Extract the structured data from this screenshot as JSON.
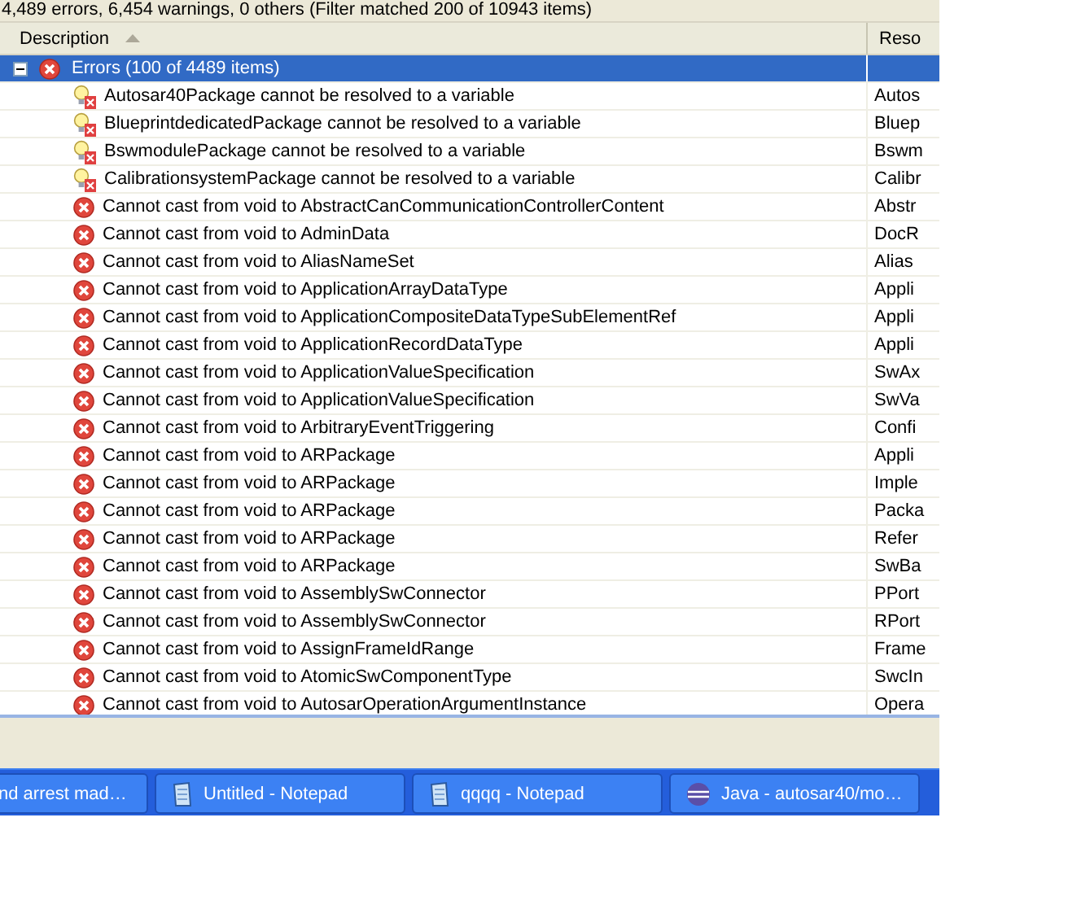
{
  "status_text": "4,489 errors, 6,454 warnings, 0 others (Filter matched 200 of 10943 items)",
  "table": {
    "columns": [
      {
        "label": "Description",
        "sorted": true
      },
      {
        "label": "Reso"
      }
    ],
    "group": {
      "label": "Errors (100 of 4489 items)",
      "expanded": true,
      "selected": true,
      "rows": [
        {
          "kind": "unresolved",
          "description": "Autosar40Package cannot be resolved to a variable",
          "resource": "Autos",
          "selected": false
        },
        {
          "kind": "unresolved",
          "description": "BlueprintdedicatedPackage cannot be resolved to a variable",
          "resource": "Bluep",
          "selected": false
        },
        {
          "kind": "unresolved",
          "description": "BswmodulePackage cannot be resolved to a variable",
          "resource": "Bswm",
          "selected": false
        },
        {
          "kind": "unresolved",
          "description": "CalibrationsystemPackage cannot be resolved to a variable",
          "resource": "Calibr",
          "selected": false
        },
        {
          "kind": "error",
          "description": "Cannot cast from void to AbstractCanCommunicationControllerContent",
          "resource": "Abstr",
          "selected": false
        },
        {
          "kind": "error",
          "description": "Cannot cast from void to AdminData",
          "resource": "DocR",
          "selected": false
        },
        {
          "kind": "error",
          "description": "Cannot cast from void to AliasNameSet",
          "resource": "Alias",
          "selected": false
        },
        {
          "kind": "error",
          "description": "Cannot cast from void to ApplicationArrayDataType",
          "resource": "Appli",
          "selected": false
        },
        {
          "kind": "error",
          "description": "Cannot cast from void to ApplicationCompositeDataTypeSubElementRef",
          "resource": "Appli",
          "selected": false
        },
        {
          "kind": "error",
          "description": "Cannot cast from void to ApplicationRecordDataType",
          "resource": "Appli",
          "selected": false
        },
        {
          "kind": "error",
          "description": "Cannot cast from void to ApplicationValueSpecification",
          "resource": "SwAx",
          "selected": false
        },
        {
          "kind": "error",
          "description": "Cannot cast from void to ApplicationValueSpecification",
          "resource": "SwVa",
          "selected": false
        },
        {
          "kind": "error",
          "description": "Cannot cast from void to ArbitraryEventTriggering",
          "resource": "Confi",
          "selected": false
        },
        {
          "kind": "error",
          "description": "Cannot cast from void to ARPackage",
          "resource": "Appli",
          "selected": false
        },
        {
          "kind": "error",
          "description": "Cannot cast from void to ARPackage",
          "resource": "Imple",
          "selected": false
        },
        {
          "kind": "error",
          "description": "Cannot cast from void to ARPackage",
          "resource": "Packa",
          "selected": false
        },
        {
          "kind": "error",
          "description": "Cannot cast from void to ARPackage",
          "resource": "Refer",
          "selected": false
        },
        {
          "kind": "error",
          "description": "Cannot cast from void to ARPackage",
          "resource": "SwBa",
          "selected": false
        },
        {
          "kind": "error",
          "description": "Cannot cast from void to AssemblySwConnector",
          "resource": "PPort",
          "selected": false
        },
        {
          "kind": "error",
          "description": "Cannot cast from void to AssemblySwConnector",
          "resource": "RPort",
          "selected": false
        },
        {
          "kind": "error",
          "description": "Cannot cast from void to AssignFrameIdRange",
          "resource": "Frame",
          "selected": false
        },
        {
          "kind": "error",
          "description": "Cannot cast from void to AtomicSwComponentType",
          "resource": "SwcIn",
          "selected": false
        },
        {
          "kind": "error",
          "description": "Cannot cast from void to AutosarOperationArgumentInstance",
          "resource": "Opera",
          "selected": false
        }
      ]
    }
  },
  "taskbar": {
    "buttons": [
      {
        "kind": "plain",
        "label": "nd arrest mad…"
      },
      {
        "kind": "notepad",
        "label": "Untitled - Notepad"
      },
      {
        "kind": "notepad",
        "label": "qqqq - Notepad"
      },
      {
        "kind": "java",
        "label": "Java - autosar40/mo…"
      }
    ]
  }
}
